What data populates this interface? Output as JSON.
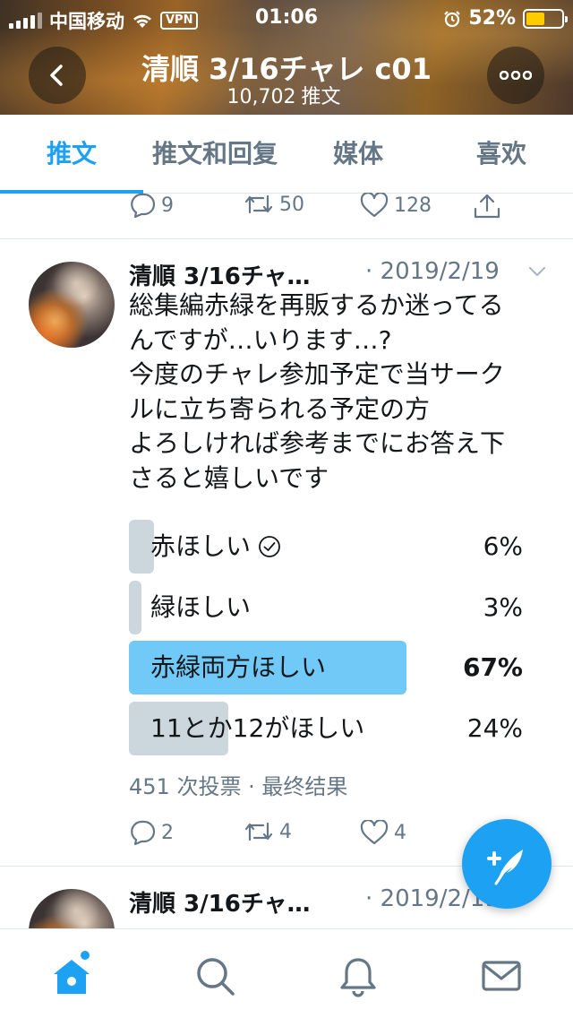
{
  "status_bar": {
    "carrier": "中国移动",
    "vpn": "VPN",
    "time": "01:06",
    "battery": "52%",
    "battery_level": 0.52
  },
  "header": {
    "title": "清順 3/16チャレ c01",
    "tweet_count": "10,702",
    "tweet_count_label": "推文"
  },
  "tabs": [
    {
      "label": "推文",
      "active": true
    },
    {
      "label": "推文和回复",
      "active": false
    },
    {
      "label": "媒体",
      "active": false
    },
    {
      "label": "喜欢",
      "active": false
    }
  ],
  "prev_tweet_actions": {
    "replies": "9",
    "retweets": "50",
    "likes": "128"
  },
  "tweet": {
    "author": "清順 3/16チャ…",
    "date": "· 2019/2/19",
    "text_lines": [
      "総集編赤緑を再販するか迷ってる",
      "んですが…いります…?",
      "今度のチャレ参加予定で当サーク",
      "ルに立ち寄られる予定の方",
      "よろしければ参考までにお答え下",
      "さると嬉しいです"
    ],
    "poll": {
      "options": [
        {
          "label": "赤ほしい",
          "percent": "6%",
          "value": 6,
          "voted": true
        },
        {
          "label": "緑ほしい",
          "percent": "3%",
          "value": 3,
          "voted": false
        },
        {
          "label": "赤緑両方ほしい",
          "percent": "67%",
          "value": 67,
          "voted": false
        },
        {
          "label": "11とか12がほしい",
          "percent": "24%",
          "value": 24,
          "voted": false
        }
      ],
      "votes": "451",
      "votes_label": "次投票",
      "result_label": "· 最终结果"
    },
    "actions": {
      "replies": "2",
      "retweets": "4",
      "likes": "4"
    }
  },
  "next_tweet": {
    "author": "清順 3/16チャ…",
    "date": "· 2019/2/19"
  },
  "bottom_nav": [
    "home-icon",
    "search-icon",
    "notifications-icon",
    "messages-icon"
  ],
  "colors": {
    "accent": "#1da1f2",
    "poll_winner": "#71c9f8",
    "poll_bar": "#ccd6dd",
    "muted": "#657786"
  }
}
